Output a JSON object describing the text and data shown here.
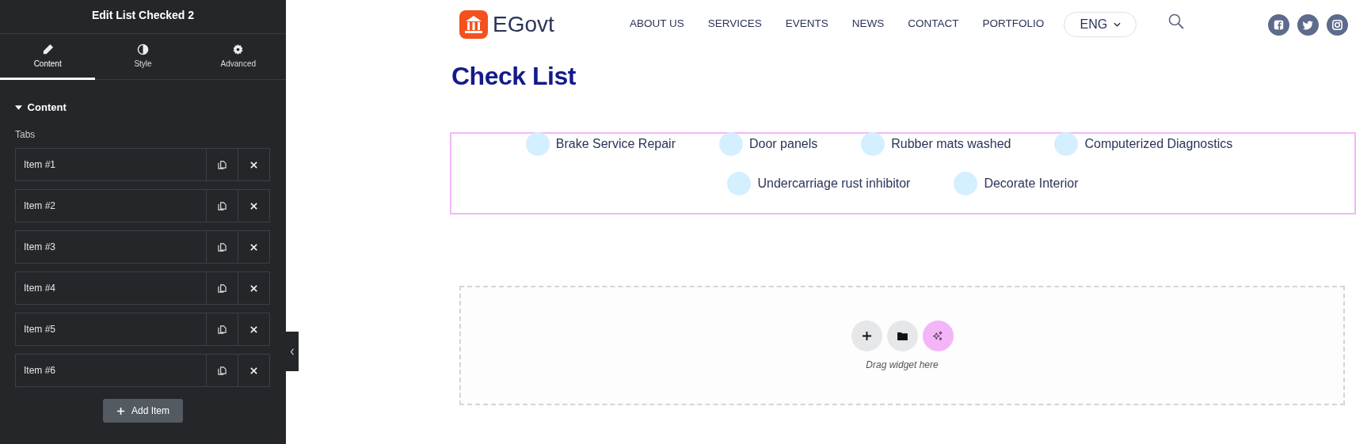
{
  "panel": {
    "title": "Edit List Checked 2",
    "tabs": [
      {
        "label": "Content",
        "selected": true
      },
      {
        "label": "Style",
        "selected": false
      },
      {
        "label": "Advanced",
        "selected": false
      }
    ],
    "section": {
      "title": "Content",
      "expanded": true
    },
    "repeater_label": "Tabs",
    "items": [
      "Item #1",
      "Item #2",
      "Item #3",
      "Item #4",
      "Item #5",
      "Item #6"
    ],
    "add_button": "Add Item"
  },
  "site": {
    "logo_text": "EGovt",
    "nav": [
      "ABOUT US",
      "SERVICES",
      "EVENTS",
      "NEWS",
      "CONTACT",
      "PORTFOLIO"
    ],
    "language": "ENG"
  },
  "heading": "Check List",
  "checklist": {
    "items": [
      "Brake Service Repair",
      "Door panels",
      "Rubber mats washed",
      "Computerized Diagnostics",
      "Undercarriage rust inhibitor",
      "Decorate Interior"
    ]
  },
  "drop_area": {
    "hint": "Drag widget here"
  }
}
